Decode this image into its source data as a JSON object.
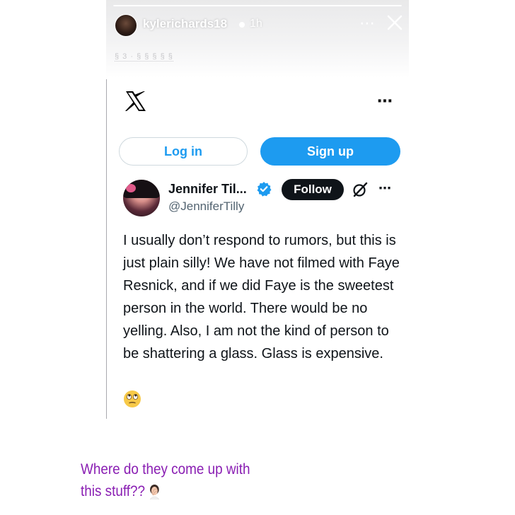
{
  "story": {
    "username": "kylerichards18",
    "time_ago": "1h",
    "progress": 1.0,
    "tiny_label": "§ 3 · § § § § §",
    "more_icon": "ellipsis-icon",
    "close_icon": "close-icon"
  },
  "tweet_card": {
    "logo_icon": "x-logo-icon",
    "login_label": "Log in",
    "signup_label": "Sign up",
    "display_name": "Jennifer Til...",
    "handle": "@JenniferTilly",
    "follow_label": "Follow",
    "text": "I usually don’t respond to rumors, but this is just plain silly! We have not filmed with Faye Resnick, and if we did  Faye is the sweetest person in the world. There would be no yelling. Also, I am not the kind of person to be shattering a glass. Glass is expensive.",
    "emoji": "face-with-rolling-eyes"
  },
  "caption": {
    "text": "Where do they come up with this stuff??",
    "emoji": "woman-facepalming"
  },
  "colors": {
    "twitter_blue": "#1d9bf0",
    "caption_purple": "#8a1fb3",
    "text_dark": "#0f1419",
    "handle_gray": "#536471"
  }
}
